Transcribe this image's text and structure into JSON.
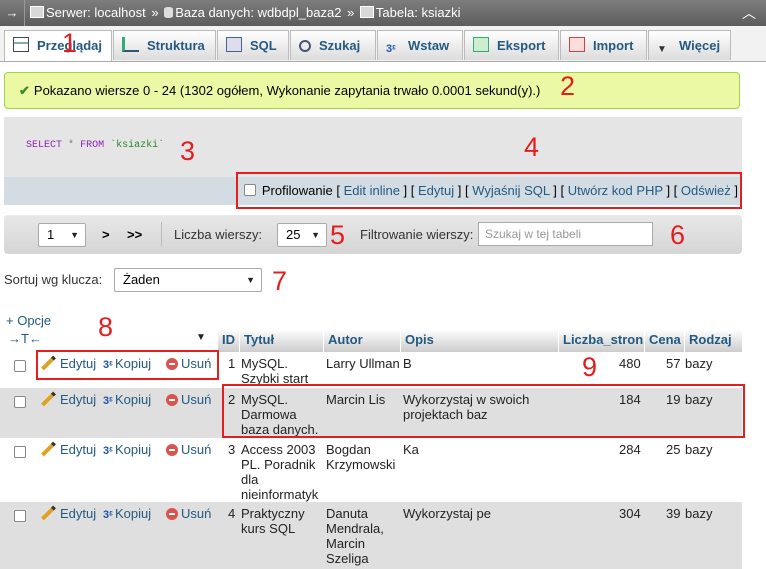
{
  "breadcrumb": {
    "server": "Serwer: localhost",
    "database": "Baza danych: wdbdpl_baza2",
    "table": "Tabela: ksiazki",
    "sep": "»"
  },
  "tabs": [
    {
      "label": "Przeglądaj",
      "icon": "browse-icon"
    },
    {
      "label": "Struktura",
      "icon": "structure-icon"
    },
    {
      "label": "SQL",
      "icon": "sql-icon"
    },
    {
      "label": "Szukaj",
      "icon": "search-icon"
    },
    {
      "label": "Wstaw",
      "icon": "insert-icon"
    },
    {
      "label": "Eksport",
      "icon": "export-icon"
    },
    {
      "label": "Import",
      "icon": "import-icon"
    },
    {
      "label": "Więcej",
      "icon": "chevron-down-icon"
    }
  ],
  "message": "Pokazano wiersze 0 - 24 (1302 ogółem, Wykonanie zapytania trwało 0.0001 sekund(y).)",
  "sql": {
    "select": "SELECT",
    "star": "*",
    "from": "FROM",
    "table": "`ksiazki`"
  },
  "actions": {
    "profiling": "Profilowanie",
    "edit_inline": "Edit inline",
    "edit": "Edytuj",
    "explain": "Wyjaśnij SQL",
    "create_php": "Utwórz kod PHP",
    "refresh": "Odśwież"
  },
  "navigation": {
    "page": "1",
    "next": ">",
    "last": ">>",
    "rows_label": "Liczba wierszy:",
    "rows_value": "25",
    "filter_label": "Filtrowanie wierszy:",
    "filter_placeholder": "Szukaj w tej tabeli"
  },
  "sort": {
    "label": "Sortuj wg klucza:",
    "value": "Żaden"
  },
  "options_link": "+ Opcje",
  "table": {
    "columns": [
      "ID",
      "Tytuł",
      "Autor",
      "Opis",
      "Liczba_stron",
      "Cena",
      "Rodzaj"
    ],
    "row_actions": {
      "edit": "Edytuj",
      "copy": "Kopiuj",
      "delete": "Usuń"
    },
    "rows": [
      {
        "id": "1",
        "tytul": [
          "MySQL.",
          "Szybki start"
        ],
        "autor": [
          "Larry Ullman"
        ],
        "opis": [
          "B"
        ],
        "strony": "480",
        "cena": "57",
        "rodzaj": "bazy"
      },
      {
        "id": "2",
        "tytul": [
          "MySQL.",
          "Darmowa",
          "baza danych."
        ],
        "autor": [
          "Marcin Lis"
        ],
        "opis": [
          "Wykorzystaj w swoich",
          "projektach baz"
        ],
        "strony": "184",
        "cena": "19",
        "rodzaj": "bazy"
      },
      {
        "id": "3",
        "tytul": [
          "Access 2003",
          "PL. Poradnik",
          "dla",
          "nieinformatyk"
        ],
        "autor": [
          "Bogdan",
          "Krzymowski"
        ],
        "opis": [
          "Ka"
        ],
        "strony": "284",
        "cena": "25",
        "rodzaj": "bazy"
      },
      {
        "id": "4",
        "tytul": [
          "Praktyczny",
          "kurs SQL"
        ],
        "autor": [
          "Danuta",
          "Mendrala,",
          "Marcin",
          "Szeliga"
        ],
        "opis": [
          "Wykorzystaj pe"
        ],
        "strony": "304",
        "cena": "39",
        "rodzaj": "bazy"
      }
    ]
  },
  "annotations": [
    "1",
    "2",
    "3",
    "4",
    "5",
    "6",
    "7",
    "8",
    "9"
  ],
  "colors": {
    "annotation": "#e41d1d",
    "link": "#235a81",
    "success_bg": "#ebf8a4"
  }
}
